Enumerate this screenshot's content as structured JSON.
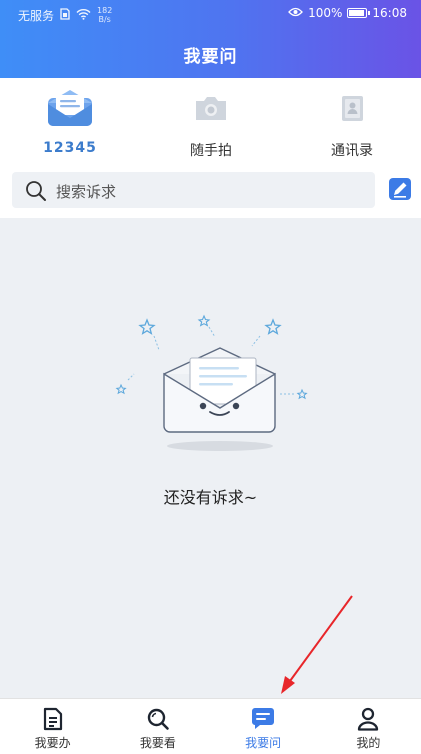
{
  "status_bar": {
    "carrier": "无服务",
    "net_speed_value": "182",
    "net_speed_unit": "B/s",
    "battery": "100%",
    "battery_level": 1.0,
    "time": "16:08"
  },
  "header": {
    "title": "我要问"
  },
  "quick_actions": [
    {
      "label": "12345",
      "icon": "envelope-icon"
    },
    {
      "label": "随手拍",
      "icon": "camera-icon"
    },
    {
      "label": "通讯录",
      "icon": "contacts-icon"
    }
  ],
  "search": {
    "placeholder": "搜索诉求",
    "icon": "search-icon"
  },
  "empty_state": {
    "message": "还没有诉求~",
    "icon": "empty-mail-icon"
  },
  "tabbar": {
    "items": [
      {
        "label": "我要办",
        "icon": "document-icon",
        "active": false
      },
      {
        "label": "我要看",
        "icon": "search-icon",
        "active": false
      },
      {
        "label": "我要问",
        "icon": "chat-icon",
        "active": true
      },
      {
        "label": "我的",
        "icon": "person-icon",
        "active": false
      }
    ]
  },
  "colors": {
    "header_start": "#3f8ef7",
    "header_end": "#6a53e6",
    "accent": "#3c7be6",
    "page_background": "#edf0f4",
    "annotation": "#e8262a"
  }
}
